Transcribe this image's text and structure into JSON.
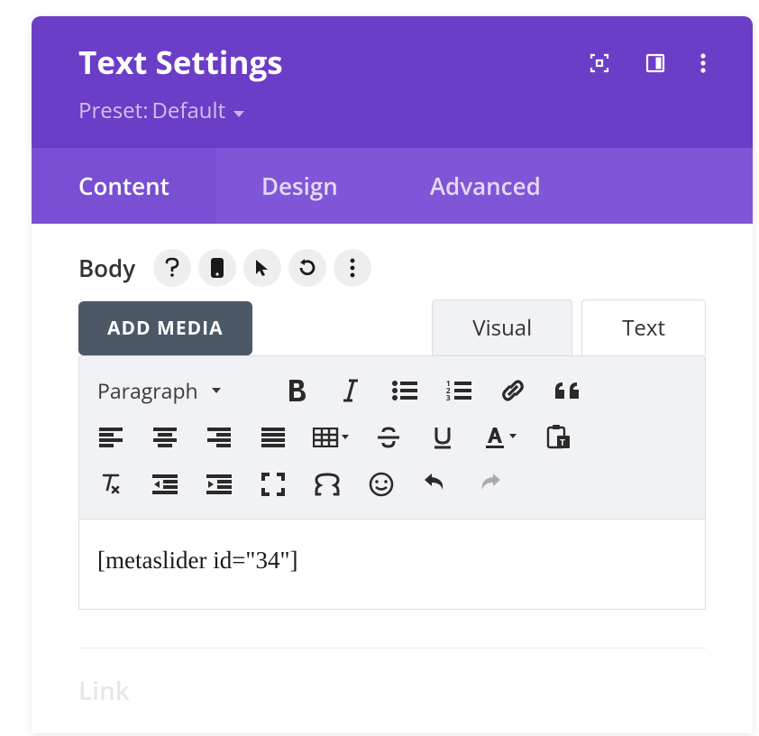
{
  "header": {
    "title": "Text Settings",
    "preset_label": "Preset:",
    "preset_value": "Default"
  },
  "tabs": [
    {
      "label": "Content",
      "active": true
    },
    {
      "label": "Design",
      "active": false
    },
    {
      "label": "Advanced",
      "active": false
    }
  ],
  "body_section": {
    "label": "Body"
  },
  "buttons": {
    "add_media": "ADD MEDIA"
  },
  "editor_tabs": {
    "visual": "Visual",
    "text": "Text"
  },
  "format_selector": {
    "value": "Paragraph"
  },
  "editor_content": "[metaslider id=\"34\"]",
  "next_section": {
    "label": "Link"
  },
  "colors": {
    "header_bg": "#6c3dc7",
    "tab_bg": "#8055d8"
  }
}
